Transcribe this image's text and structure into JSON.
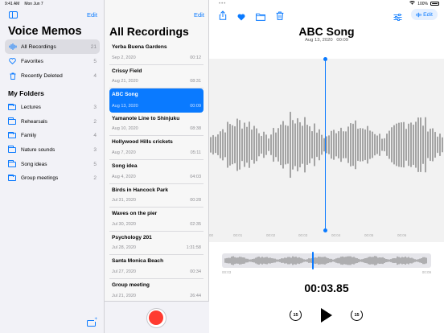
{
  "status": {
    "time": "9:41 AM",
    "date": "Mon Jun 7",
    "battery": "100%"
  },
  "sidebar": {
    "edit_label": "Edit",
    "title": "Voice Memos",
    "items": [
      {
        "label": "All Recordings",
        "count": "21",
        "icon": "waveform-icon"
      },
      {
        "label": "Favorites",
        "count": "5",
        "icon": "heart-icon"
      },
      {
        "label": "Recently Deleted",
        "count": "4",
        "icon": "trash-icon"
      }
    ],
    "folders_title": "My Folders",
    "folders": [
      {
        "label": "Lectures",
        "count": "3"
      },
      {
        "label": "Rehearsals",
        "count": "2"
      },
      {
        "label": "Family",
        "count": "4"
      },
      {
        "label": "Nature sounds",
        "count": "3"
      },
      {
        "label": "Song ideas",
        "count": "5"
      },
      {
        "label": "Group meetings",
        "count": "2"
      }
    ]
  },
  "list": {
    "edit_label": "Edit",
    "title": "All Recordings",
    "recordings": [
      {
        "name": "Yerba Buena Gardens",
        "date": "Sep 2, 2020",
        "duration": "00:12"
      },
      {
        "name": "Crissy Field",
        "date": "Aug 21, 2020",
        "duration": "08:31"
      },
      {
        "name": "ABC Song",
        "date": "Aug 13, 2020",
        "duration": "00:09"
      },
      {
        "name": "Yamanote Line to Shinjuku",
        "date": "Aug 10, 2020",
        "duration": "08:38"
      },
      {
        "name": "Hollywood Hills crickets",
        "date": "Aug 7, 2020",
        "duration": "05:11"
      },
      {
        "name": "Song idea",
        "date": "Aug 4, 2020",
        "duration": "04:03"
      },
      {
        "name": "Birds in Hancock Park",
        "date": "Jul 31, 2020",
        "duration": "00:28"
      },
      {
        "name": "Waves on the pier",
        "date": "Jul 30, 2020",
        "duration": "02:35"
      },
      {
        "name": "Psychology 201",
        "date": "Jul 28, 2020",
        "duration": "1:31:58"
      },
      {
        "name": "Santa Monica Beach",
        "date": "Jul 27, 2020",
        "duration": "00:34"
      },
      {
        "name": "Group meeting",
        "date": "Jul 21, 2020",
        "duration": "26:44"
      }
    ],
    "selected_index": 2
  },
  "detail": {
    "edit_label": "Edit",
    "title": "ABC Song",
    "date": "Aug 13, 2020",
    "duration": "00:09",
    "time_ticks": [
      "00",
      "00:01",
      "00:02",
      "00:03",
      "00:04",
      "00:05",
      "00:06"
    ],
    "mini_start": "00:03",
    "mini_end": "00:09",
    "elapsed": "00:03.85",
    "skip_back_label": "15",
    "skip_fwd_label": "15"
  },
  "colors": {
    "accent": "#0a7aff",
    "record": "#ff3b30",
    "selected_row": "#0a7aff"
  }
}
